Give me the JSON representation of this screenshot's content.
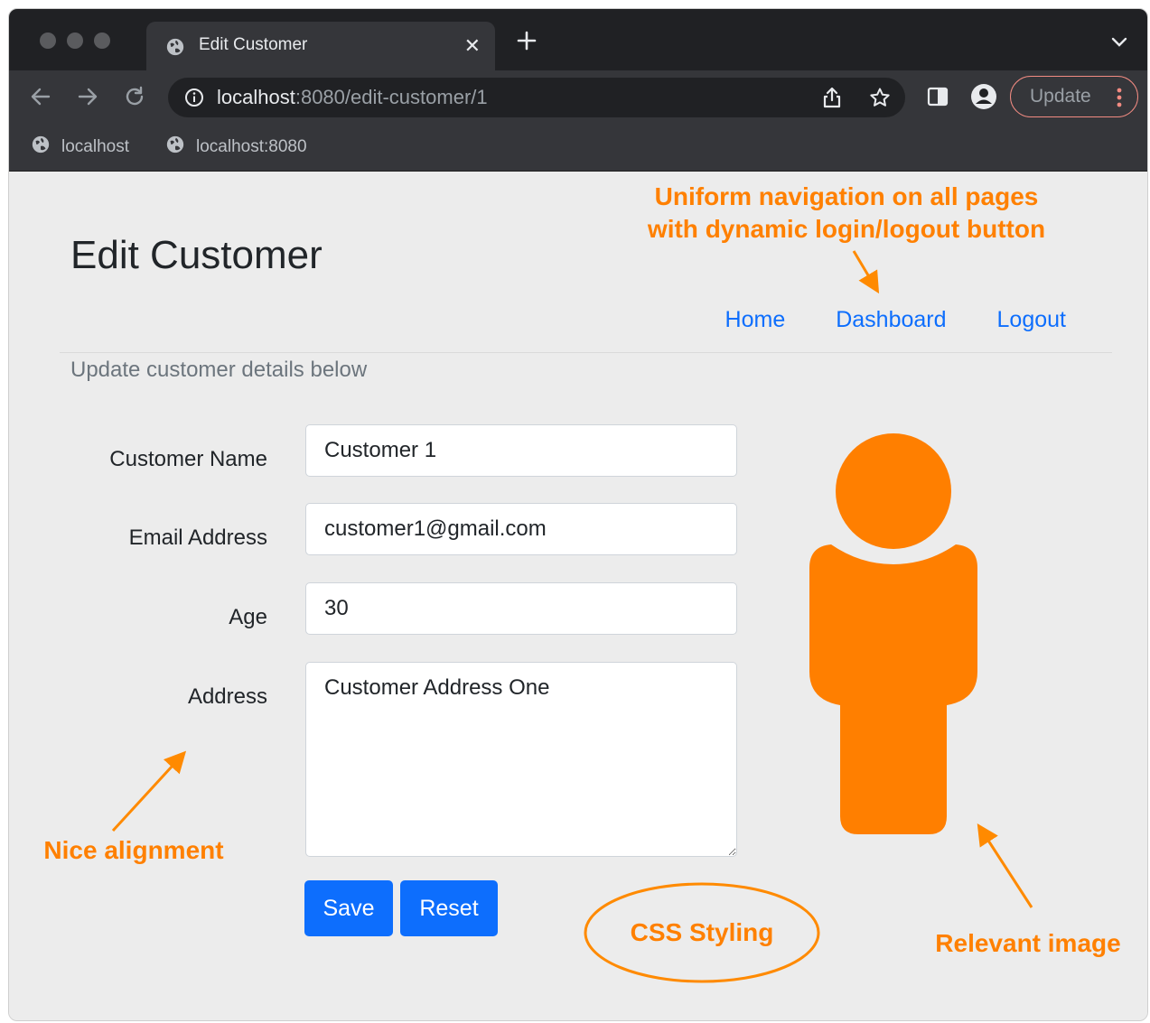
{
  "browser": {
    "tab_title": "Edit Customer",
    "url_host": "localhost",
    "url_rest": ":8080/edit-customer/1",
    "update_label": "Update",
    "bookmarks": [
      {
        "label": "localhost"
      },
      {
        "label": "localhost:8080"
      }
    ]
  },
  "page": {
    "title": "Edit Customer",
    "subtitle": "Update customer details below",
    "nav": [
      "Home",
      "Dashboard",
      "Logout"
    ],
    "form": {
      "name_label": "Customer Name",
      "name_value": "Customer 1",
      "email_label": "Email Address",
      "email_value": "customer1@gmail.com",
      "age_label": "Age",
      "age_value": "30",
      "address_label": "Address",
      "address_value": "Customer Address One"
    },
    "buttons": {
      "save": "Save",
      "reset": "Reset"
    }
  },
  "annotations": {
    "nav_note": "Uniform navigation on all pages with dynamic login/logout button",
    "alignment_note": "Nice alignment",
    "css_note": "CSS Styling",
    "image_note": "Relevant image"
  },
  "colors": {
    "accent_orange": "#ff8000",
    "primary_blue": "#0d6efd",
    "browser_dark": "#202124",
    "toolbar": "#35363a",
    "page_bg": "#ececec"
  },
  "icons": [
    "globe-icon",
    "close-icon",
    "plus-icon",
    "chevron-down-icon",
    "back-arrow-icon",
    "forward-arrow-icon",
    "reload-icon",
    "info-icon",
    "share-icon",
    "star-icon",
    "side-panel-icon",
    "profile-icon",
    "kebab-menu-icon",
    "person-icon"
  ]
}
